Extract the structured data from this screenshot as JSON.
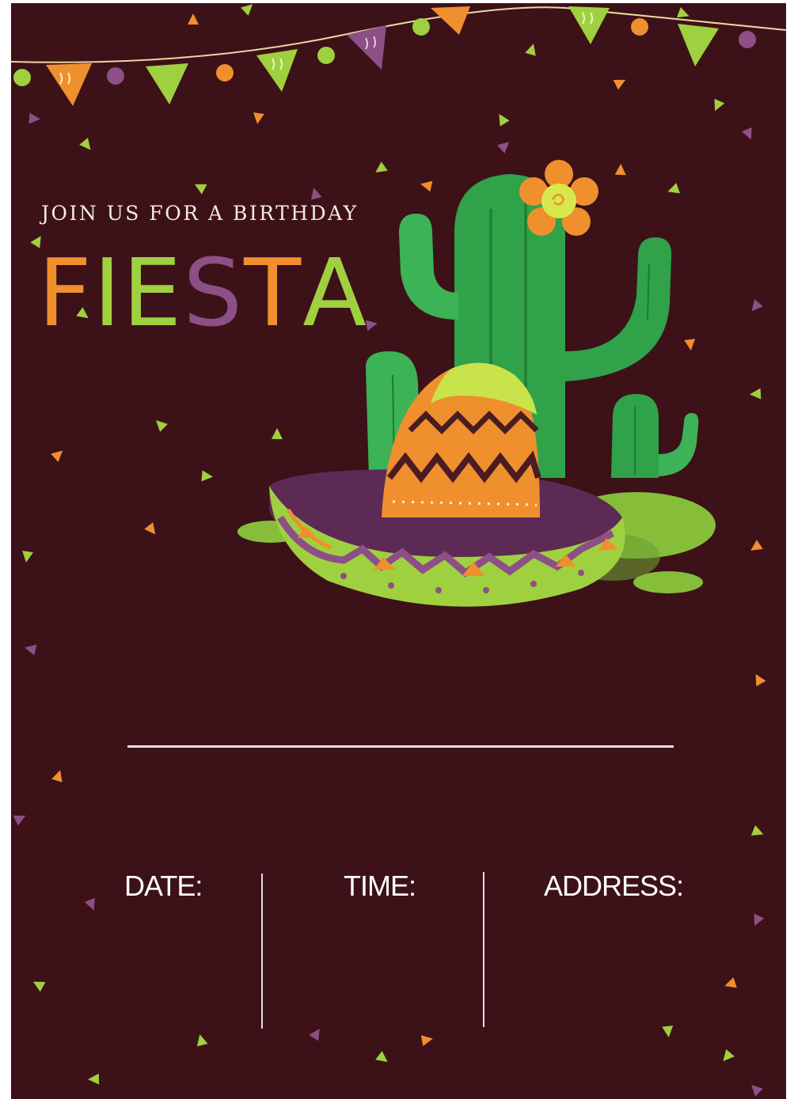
{
  "invitation": {
    "tagline": "JOIN US FOR A BIRTHDAY",
    "title_letters": [
      "F",
      "I",
      "E",
      "S",
      "T",
      "A"
    ],
    "title_colors": [
      "#ef8f2e",
      "#9fd040",
      "#9fd040",
      "#8d4f86",
      "#ef8f2e",
      "#9fd040"
    ],
    "fields": {
      "date_label": "DATE:",
      "time_label": "TIME:",
      "address_label": "ADDRESS:"
    }
  },
  "palette": {
    "background": "#3d1118",
    "orange": "#ef8f2e",
    "lime": "#9fd040",
    "purple": "#8d4f86",
    "cactus_green": "#2fa24a",
    "line": "#e8dfe0"
  },
  "illustration": {
    "subjects": [
      "bunting-garland",
      "cactus",
      "sombrero",
      "flower",
      "confetti"
    ]
  }
}
